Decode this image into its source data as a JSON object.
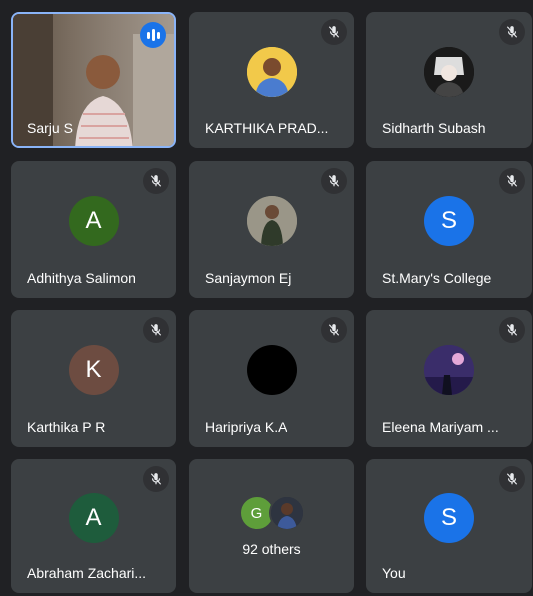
{
  "tiles": {
    "t1": {
      "name": "Sarju S"
    },
    "t2": {
      "name": "KARTHIKA PRAD..."
    },
    "t3": {
      "name": "Sidharth Subash"
    },
    "t4": {
      "name": "Adhithya Salimon",
      "initial": "A"
    },
    "t5": {
      "name": "Sanjaymon Ej"
    },
    "t6": {
      "name": "St.Mary's College",
      "initial": "S"
    },
    "t7": {
      "name": "Karthika P R",
      "initial": "K"
    },
    "t8": {
      "name": "Haripriya K.A"
    },
    "t9": {
      "name": "Eleena Mariyam ..."
    },
    "t10": {
      "name": "Abraham Zachari...",
      "initial": "A"
    },
    "t11": {
      "label": "92 others",
      "initial": "G"
    },
    "t12": {
      "name": "You",
      "initial": "S"
    }
  },
  "colors": {
    "tile_bg": "#3c4043",
    "page_bg": "#202124",
    "active_border": "#8ab4f8",
    "speaking_badge": "#1a73e8",
    "avatar_green": "#33691e",
    "avatar_blue": "#1a73e8",
    "avatar_brown": "#6d4c41",
    "avatar_teal": "#1e5c3c"
  },
  "icons": {
    "mute": "mic-off-icon",
    "speaking": "audio-level-icon"
  }
}
